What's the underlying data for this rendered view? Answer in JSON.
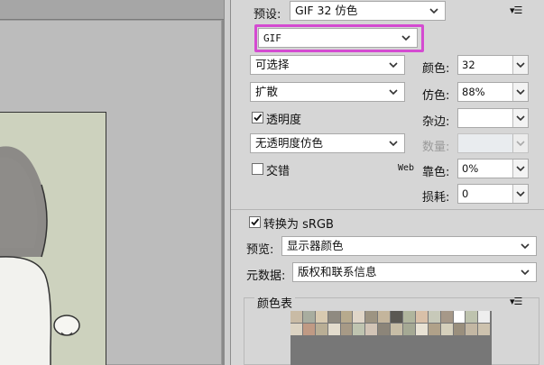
{
  "preset": {
    "label": "预设:",
    "value": "GIF 32 仿色"
  },
  "format": {
    "value": "GIF"
  },
  "reduction": {
    "value": "可选择"
  },
  "dither_algorithm": {
    "value": "扩散"
  },
  "transparency": {
    "label": "透明度",
    "checked": true
  },
  "matte_dither": {
    "value": "无透明度仿色"
  },
  "interlaced": {
    "label": "交错",
    "checked": false
  },
  "colors": {
    "label": "颜色:",
    "value": "32"
  },
  "dither": {
    "label": "仿色:",
    "value": "88%"
  },
  "matte": {
    "label": "杂边:",
    "value": ""
  },
  "amount": {
    "label": "数量:",
    "value": ""
  },
  "web_snap": {
    "label_prefix": "Web",
    "label": "靠色:",
    "value": "0%"
  },
  "lossy": {
    "label": "损耗:",
    "value": "0"
  },
  "convert_srgb": {
    "label": "转换为 sRGB",
    "checked": true
  },
  "preview": {
    "label": "预览:",
    "value": "显示器颜色"
  },
  "metadata": {
    "label": "元数据:",
    "value": "版权和联系信息"
  },
  "color_table": {
    "label": "颜色表",
    "swatches": [
      "#c9bba5",
      "#a8ad9f",
      "#d8cab0",
      "#8f8a80",
      "#b7aa8d",
      "#e0d6c8",
      "#9d9482",
      "#c4b59c",
      "#5a5853",
      "#b0b59d",
      "#d9c0a8",
      "#c7c9b9",
      "#a69888",
      "#ffffff",
      "#bec3ae",
      "#eeeeee",
      "#dcd3c2",
      "#c09a84",
      "#b9ae95",
      "#e3dccd",
      "#a79a86",
      "#bfc4b0",
      "#d2c4b6",
      "#8c8579",
      "#c7bda6",
      "#a5a994",
      "#e8e2d4",
      "#b0a189",
      "#d6d0bc",
      "#9a8f7d",
      "#c3b7a3",
      "#cdc2ae"
    ]
  },
  "menu_icon": "flyout-menu-icon"
}
